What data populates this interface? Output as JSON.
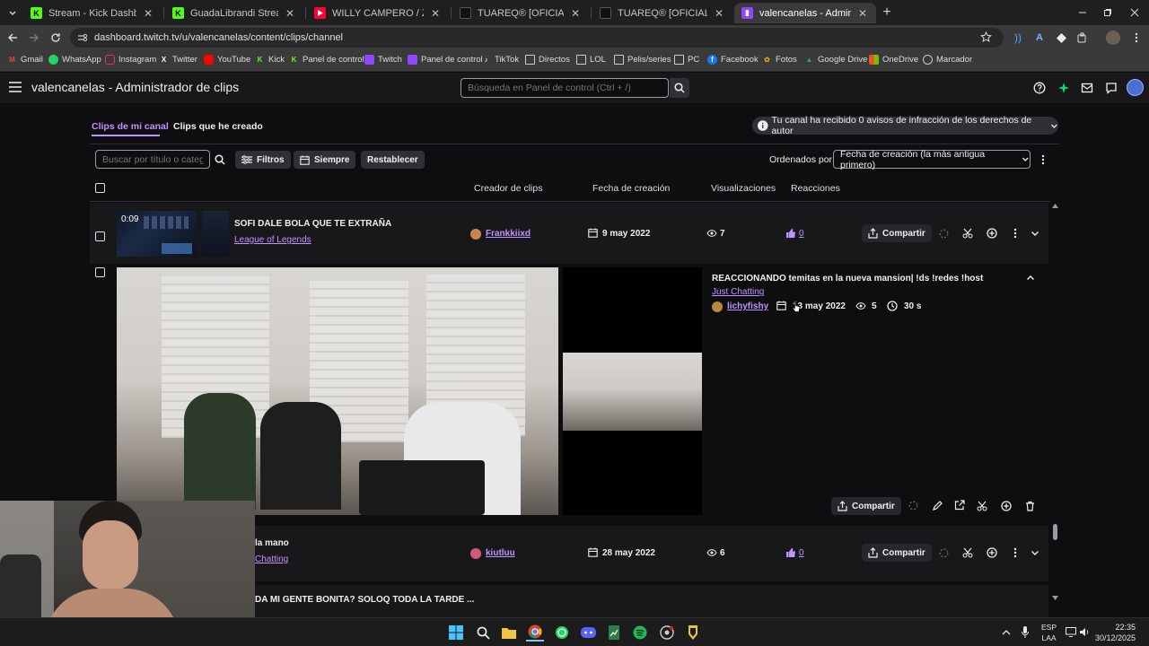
{
  "browser": {
    "tabs": [
      {
        "title": "Stream - Kick Dashboard",
        "favicon_color": "#53fc18",
        "active": false
      },
      {
        "title": "GuadaLibrandi Stream - Watch",
        "favicon_color": "#53fc18",
        "active": false
      },
      {
        "title": "WILLY CAMPERO / Zapada EN V",
        "favicon_color": "#ff0033",
        "active": false
      },
      {
        "title": "TUAREQ® [OFICIAL] - JEAN M",
        "favicon_color": "#111111",
        "active": false
      },
      {
        "title": "TUAREQ® [OFICIAL] - REMERA",
        "favicon_color": "#111111",
        "active": false
      },
      {
        "title": "valencanelas - Administrador d",
        "favicon_color": "#9146ff",
        "active": true
      }
    ],
    "url": "dashboard.twitch.tv/u/valencanelas/content/clips/channel",
    "bookmarks": [
      {
        "label": "Gmail",
        "icon": "gmail-icon",
        "color": "#ea4335"
      },
      {
        "label": "WhatsApp",
        "icon": "whatsapp-icon",
        "color": "#25d366"
      },
      {
        "label": "Instagram",
        "icon": "instagram-icon",
        "color": "#e1306c"
      },
      {
        "label": "Twitter",
        "icon": "x-icon",
        "color": "#ffffff"
      },
      {
        "label": "YouTube",
        "icon": "youtube-icon",
        "color": "#ff0000"
      },
      {
        "label": "Kick",
        "icon": "kick-icon",
        "color": "#53fc18"
      },
      {
        "label": "Panel de control",
        "icon": "kick-icon",
        "color": "#53fc18"
      },
      {
        "label": "Twitch",
        "icon": "twitch-icon",
        "color": "#9146ff"
      },
      {
        "label": "Panel de control",
        "icon": "twitch-icon",
        "color": "#9146ff"
      },
      {
        "label": "TikTok",
        "icon": "tiktok-icon",
        "color": "#ffffff"
      },
      {
        "label": "Directos",
        "icon": "folder-icon",
        "color": "#cccccc"
      },
      {
        "label": "LOL",
        "icon": "folder-icon",
        "color": "#cccccc"
      },
      {
        "label": "Pelis/series",
        "icon": "folder-icon",
        "color": "#cccccc"
      },
      {
        "label": "PC",
        "icon": "folder-icon",
        "color": "#cccccc"
      },
      {
        "label": "Facebook",
        "icon": "facebook-icon",
        "color": "#1877f2"
      },
      {
        "label": "Fotos",
        "icon": "photos-icon",
        "color": "#fbbc04"
      },
      {
        "label": "Google Drive",
        "icon": "drive-icon",
        "color": "#34a853"
      },
      {
        "label": "OneDrive",
        "icon": "onedrive-icon",
        "color": "#f25022"
      },
      {
        "label": "Marcador",
        "icon": "globe-icon",
        "color": "#cccccc"
      }
    ]
  },
  "header": {
    "title": "valencanelas - Administrador de clips",
    "search_placeholder": "Búsqueda en Panel de control (Ctrl + /)"
  },
  "tabs": {
    "my_channel": "Clips de mi canal",
    "created": "Clips que he creado"
  },
  "copyright_notice": "Tu canal ha recibido 0 avisos de infracción de los derechos de autor",
  "toolbar": {
    "search_placeholder": "Buscar por título o categoría",
    "filters": "Filtros",
    "time": "Siempre",
    "reset": "Restablecer",
    "sort_label": "Ordenados por",
    "sort_value": "Fecha de creación (la más antigua primero)"
  },
  "columns": {
    "creator": "Creador de clips",
    "date": "Fecha de creación",
    "views": "Visualizaciones",
    "reactions": "Reacciones"
  },
  "rows": [
    {
      "duration": "0:09",
      "title": "SOFI DALE BOLA QUE TE EXTRAÑA",
      "category": "League of Legends",
      "creator": "Frankkiixd",
      "date": "9 may 2022",
      "views": "7",
      "reactions": "0",
      "share": "Compartir"
    },
    {
      "title": "REACCIONANDO temitas en la nueva mansion| !ds !redes !host",
      "category": "Just Chatting",
      "creator": "lichyfishy",
      "date": "13 may 2022",
      "views": "5",
      "duration": "30 s",
      "share": "Compartir",
      "expanded": true
    },
    {
      "title": "la mano",
      "category": "Chatting",
      "creator": "kiutluu",
      "date": "28 may 2022",
      "views": "6",
      "reactions": "0",
      "share": "Compartir"
    },
    {
      "title": "DA MI GENTE BONITA? SOLOQ TODA LA TARDE ..."
    }
  ],
  "taskbar": {
    "lang_line1": "ESP",
    "lang_line2": "LAA",
    "time": "22:35",
    "date": "30/12/2025"
  },
  "colors": {
    "accent": "#bf94ff",
    "twitch": "#9146ff",
    "background": "#0e0e10"
  }
}
